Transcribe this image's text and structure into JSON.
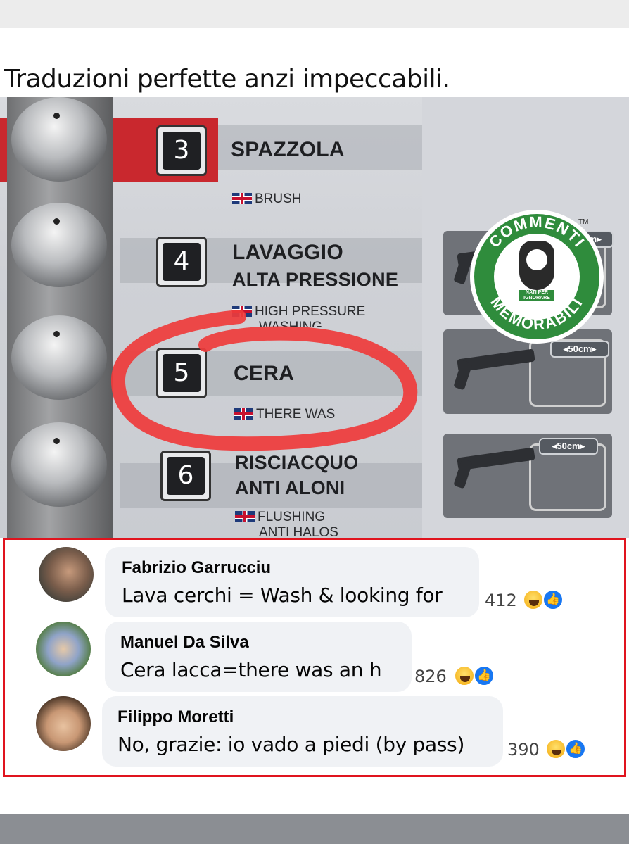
{
  "post": {
    "caption": "Traduzioni perfette anzi impeccabili."
  },
  "sign": {
    "items": [
      {
        "number": "3",
        "it_line1": "SPAZZOLA",
        "it_line2": "",
        "en_line1": "BRUSH",
        "en_line2": ""
      },
      {
        "number": "4",
        "it_line1": "LAVAGGIO",
        "it_line2": "ALTA PRESSIONE",
        "en_line1": "HIGH PRESSURE",
        "en_line2": "WASHING"
      },
      {
        "number": "5",
        "it_line1": "CERA",
        "it_line2": "",
        "en_line1": "THERE WAS",
        "en_line2": ""
      },
      {
        "number": "6",
        "it_line1": "RISCIACQUO",
        "it_line2": "ANTI ALONI",
        "en_line1": "FLUSHING",
        "en_line2": "ANTI HALOS"
      }
    ],
    "distance_badges": [
      "◂50cm▸",
      "◂50cm▸",
      "cm▸"
    ],
    "logo": {
      "top_text": "COMMENTI",
      "bottom_text": "MEMORABILI",
      "tag_text": "NATI PER IGNORARE",
      "tm": "TM"
    }
  },
  "comments": [
    {
      "author": "Fabrizio Garrucciu",
      "text": "Lava cerchi = Wash & looking for",
      "reactions": "412"
    },
    {
      "author": "Manuel Da Silva",
      "text": "Cera lacca=there was an h",
      "reactions": "826"
    },
    {
      "author": "Filippo Moretti",
      "text": "No, grazie: io vado a piedi (by pass)",
      "reactions": "390"
    }
  ],
  "colors": {
    "highlight_border": "#e0141e",
    "circle_annotation": "#ef3b3b",
    "logo_green": "#2f8c3c",
    "like_blue": "#1877f2"
  }
}
